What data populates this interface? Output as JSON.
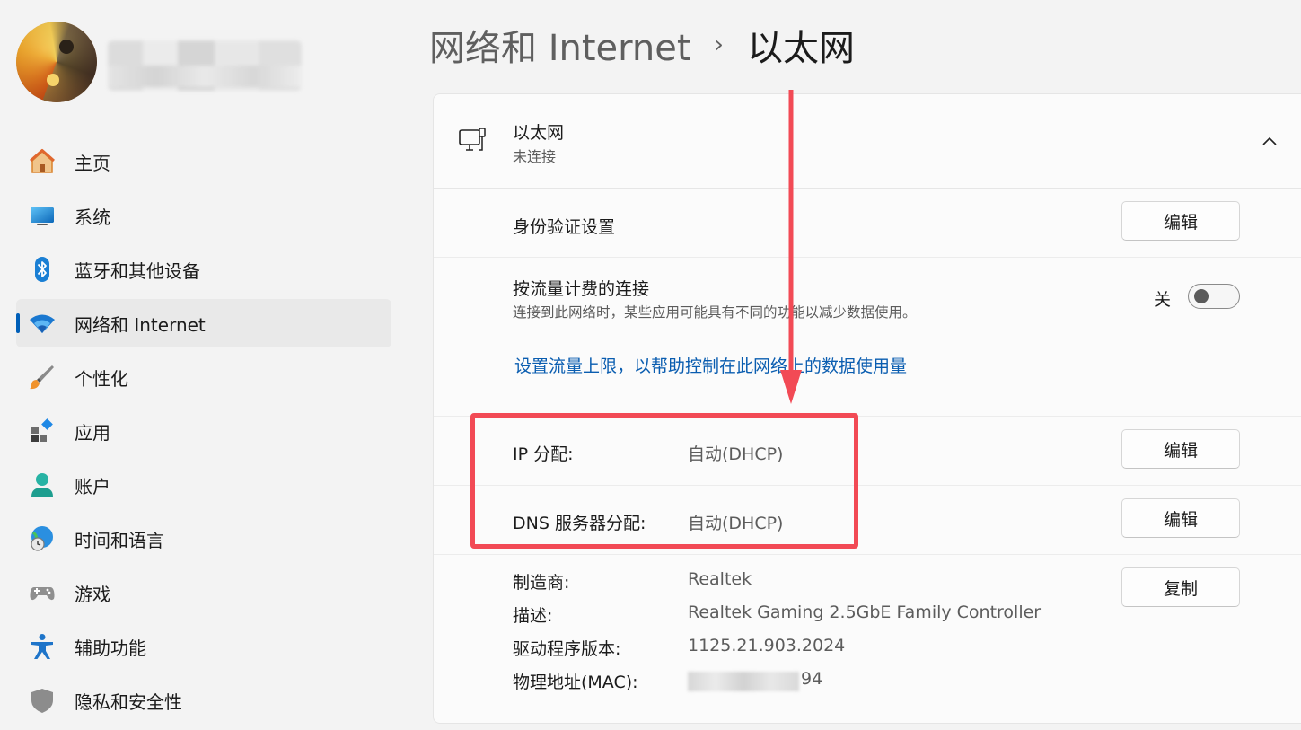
{
  "sidebar": {
    "items": [
      {
        "label": "主页",
        "icon": "home-icon"
      },
      {
        "label": "系统",
        "icon": "display-icon"
      },
      {
        "label": "蓝牙和其他设备",
        "icon": "bluetooth-icon"
      },
      {
        "label": "网络和 Internet",
        "icon": "wifi-icon",
        "active": true
      },
      {
        "label": "个性化",
        "icon": "brush-icon"
      },
      {
        "label": "应用",
        "icon": "apps-icon"
      },
      {
        "label": "账户",
        "icon": "account-icon"
      },
      {
        "label": "时间和语言",
        "icon": "globe-clock-icon"
      },
      {
        "label": "游戏",
        "icon": "gamepad-icon"
      },
      {
        "label": "辅助功能",
        "icon": "accessibility-icon"
      },
      {
        "label": "隐私和安全性",
        "icon": "shield-icon"
      }
    ]
  },
  "header": {
    "parent": "网络和 Internet",
    "separator": "›",
    "current": "以太网"
  },
  "ethernet": {
    "title": "以太网",
    "status": "未连接",
    "auth": {
      "label": "身份验证设置",
      "button": "编辑"
    },
    "metered": {
      "label": "按流量计费的连接",
      "description": "连接到此网络时，某些应用可能具有不同的功能以减少数据使用。",
      "toggle_text": "关",
      "toggle_on": false
    },
    "data_limit_link": "设置流量上限，以帮助控制在此网络上的数据使用量",
    "ip": {
      "label": "IP 分配:",
      "value": "自动(DHCP)",
      "button": "编辑"
    },
    "dns": {
      "label": "DNS 服务器分配:",
      "value": "自动(DHCP)",
      "button": "编辑"
    },
    "properties": {
      "manufacturer_label": "制造商:",
      "manufacturer": "Realtek",
      "description_label": "描述:",
      "description": "Realtek Gaming 2.5GbE Family Controller",
      "driver_label": "驱动程序版本:",
      "driver": "1125.21.903.2024",
      "mac_label": "物理地址(MAC):",
      "mac_suffix": "94",
      "copy_button": "复制"
    }
  },
  "colors": {
    "accent": "#005fb8",
    "link": "#0a5db0",
    "annotation": "#f24a55"
  }
}
